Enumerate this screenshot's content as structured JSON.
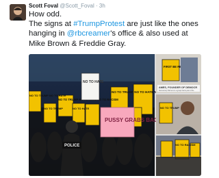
{
  "tweet": {
    "author_name": "Scott Foval",
    "handle": "@Scott_Foval",
    "separator": "·",
    "time": "3h",
    "line1": "How odd.",
    "text_a": "The signs at ",
    "hashtag": "#TrumpProtest",
    "text_b": " are just like the ones hanging in ",
    "mention": "@rbcreamer",
    "text_c": "'s office & also used at Mike Brown & Freddie Gray."
  },
  "media": {
    "signs": {
      "left_top": "NO TO TRUMP NO TO HATE",
      "center_large": "NO TO TRUMP NO TO HATE NO TO RACISM",
      "right_top": "NO TO TRUMP NO TO HATE NO TO RACISM",
      "white_sign": "NO TO HATE",
      "pink_sign": "PUSSY GRABS BACK!",
      "police_vest": "POLICE",
      "small_1": "NO TO TRUMP",
      "small_2": "NO TO HATE"
    },
    "right_panels": {
      "caption": "AMES, FOUNDER OF DEMOCR",
      "caption_sub": "Democracy Partners is a group that is part of the",
      "top_sign": "FIRST BE REMOVED",
      "mid_sign": "NO TO TRUMP",
      "bottom_sign": "NO TO RACISM"
    },
    "colors": {
      "sign_yellow": "#f2c200",
      "sign_pink": "#f8a8bd",
      "mention_blue": "#1b95e0"
    }
  }
}
